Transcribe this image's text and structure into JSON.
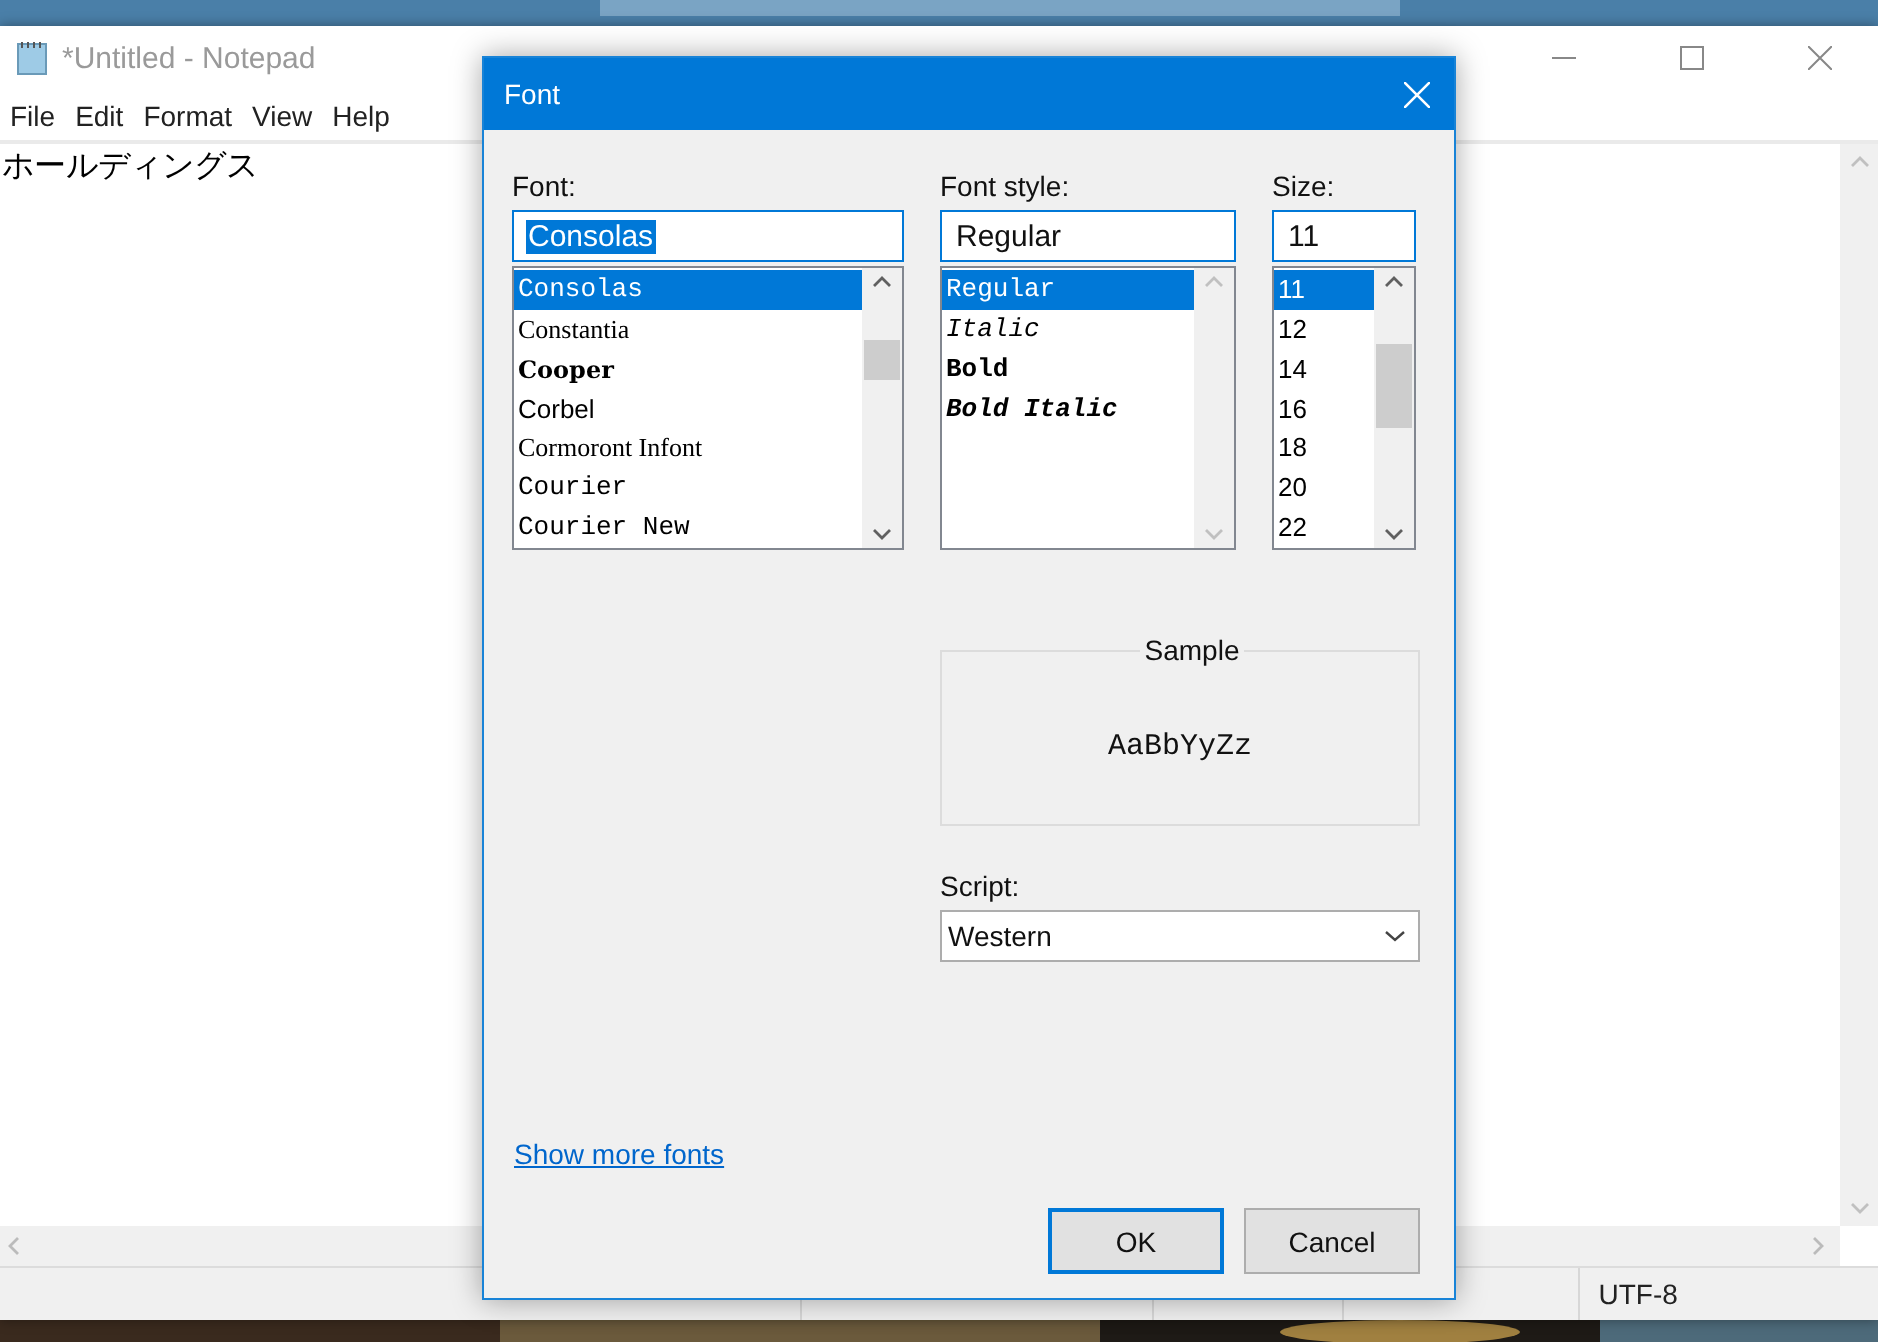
{
  "notepad": {
    "title": "*Untitled - Notepad",
    "menu": [
      "File",
      "Edit",
      "Format",
      "View",
      "Help"
    ],
    "text": "ホールディングス",
    "status": [
      "UTF-8"
    ]
  },
  "dialog": {
    "title": "Font",
    "columns": [
      {
        "label": "Font:",
        "value": "Consolas",
        "value_selected": true,
        "scrollbar_enabled": true,
        "items": [
          {
            "label": "Consolas",
            "kind": "mono",
            "selected": true
          },
          {
            "label": "Constantia",
            "kind": "serif",
            "selected": false
          },
          {
            "label": "Cooper",
            "kind": "heavy",
            "selected": false
          },
          {
            "label": "Corbel",
            "kind": "sans",
            "selected": false
          },
          {
            "label": "Cormoront Infont",
            "kind": "serif",
            "selected": false
          },
          {
            "label": "Courier",
            "kind": "mono",
            "selected": false
          },
          {
            "label": "Courier New",
            "kind": "mono",
            "selected": false
          }
        ]
      },
      {
        "label": "Font style:",
        "value": "Regular",
        "value_selected": false,
        "scrollbar_enabled": false,
        "items": [
          {
            "label": "Regular",
            "kind": "mono",
            "selected": true
          },
          {
            "label": "Italic",
            "kind": "mono-italic",
            "selected": false
          },
          {
            "label": "Bold",
            "kind": "mono-bold",
            "selected": false
          },
          {
            "label": "Bold Italic",
            "kind": "mono-bold-italic",
            "selected": false
          }
        ]
      },
      {
        "label": "Size:",
        "value": "11",
        "value_selected": false,
        "scrollbar_enabled": true,
        "items": [
          {
            "label": "11",
            "kind": "sans",
            "selected": true
          },
          {
            "label": "12",
            "kind": "sans",
            "selected": false
          },
          {
            "label": "14",
            "kind": "sans",
            "selected": false
          },
          {
            "label": "16",
            "kind": "sans",
            "selected": false
          },
          {
            "label": "18",
            "kind": "sans",
            "selected": false
          },
          {
            "label": "20",
            "kind": "sans",
            "selected": false
          },
          {
            "label": "22",
            "kind": "sans",
            "selected": false
          }
        ]
      }
    ],
    "sample": {
      "label": "Sample",
      "text": "AaBbYyZz"
    },
    "script": {
      "label": "Script:",
      "value": "Western"
    },
    "link": "Show more fonts",
    "buttons": [
      {
        "label": "OK",
        "default": true
      },
      {
        "label": "Cancel",
        "default": false
      }
    ]
  }
}
